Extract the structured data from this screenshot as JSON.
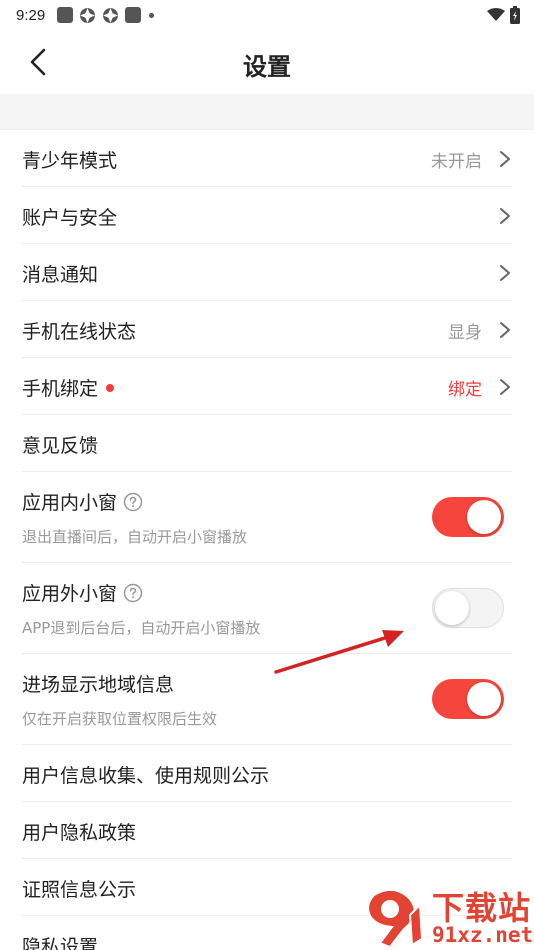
{
  "status_bar": {
    "time": "9:29"
  },
  "nav": {
    "title": "设置"
  },
  "rows": [
    {
      "label": "青少年模式",
      "value": "未开启"
    },
    {
      "label": "账户与安全"
    },
    {
      "label": "消息通知"
    },
    {
      "label": "手机在线状态",
      "value": "显身"
    },
    {
      "label": "手机绑定",
      "value": "绑定"
    },
    {
      "label": "意见反馈"
    },
    {
      "label": "应用内小窗",
      "sub": "退出直播间后，自动开启小窗播放",
      "toggle_on": true
    },
    {
      "label": "应用外小窗",
      "sub": "APP退到后台后，自动开启小窗播放",
      "toggle_on": false
    },
    {
      "label": "进场显示地域信息",
      "sub": "仅在开启获取位置权限后生效",
      "toggle_on": true
    },
    {
      "label": "用户信息收集、使用规则公示"
    },
    {
      "label": "用户隐私政策"
    },
    {
      "label": "证照信息公示"
    },
    {
      "label": "隐私设置"
    }
  ],
  "watermark": {
    "text": "下载站",
    "sub": "91xz.net"
  },
  "colors": {
    "accent": "#f6453c",
    "muted": "#999999",
    "divider": "#ececec"
  }
}
